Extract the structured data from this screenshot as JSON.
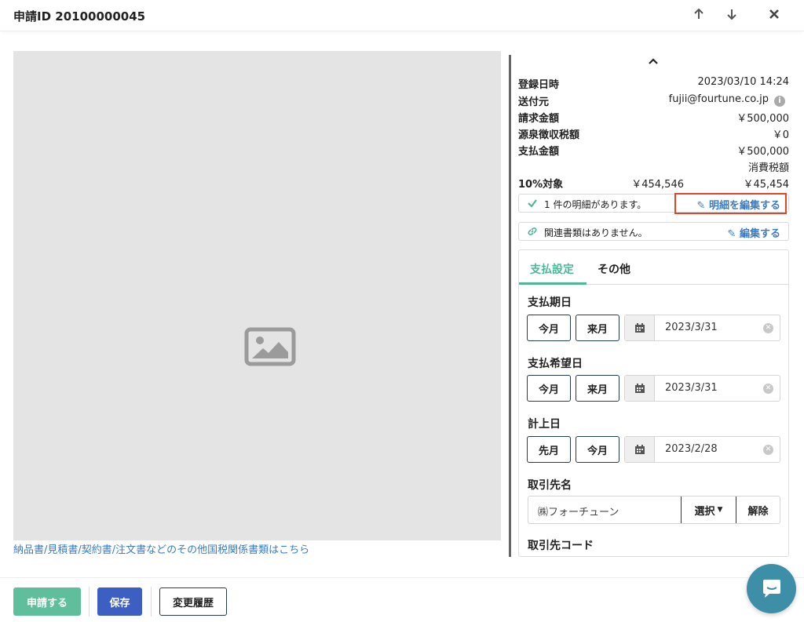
{
  "header": {
    "title": "申請ID 20100000045",
    "icons": [
      "arrow-up-icon",
      "arrow-down-icon",
      "close-icon"
    ]
  },
  "preview": {
    "placeholder_icon": "image-icon",
    "doc_link": "納品書/見積書/契約書/注文書などのその他国税関係書類はこちら"
  },
  "summary": {
    "registered_label": "登録日時",
    "registered_value": "2023/03/10 14:24",
    "sender_label": "送付元",
    "sender_value": "fujii@fourtune.co.jp",
    "invoice_amount_label": "請求金額",
    "invoice_amount_value": "￥500,000",
    "withholding_label": "源泉徴収税額",
    "withholding_value": "￥0",
    "payment_amount_label": "支払金額",
    "payment_amount_value": "￥500,000",
    "tax_header": "消費税額",
    "rate_label": "10%対象",
    "rate_base": "￥454,546",
    "rate_tax": "￥45,454"
  },
  "details_box": {
    "text": "1 件の明細があります。",
    "action": "明細を編集する"
  },
  "related_box": {
    "text": "関連書類はありません。",
    "action": "編集する"
  },
  "tabs": [
    {
      "label": "支払設定",
      "active": true
    },
    {
      "label": "その他",
      "active": false
    }
  ],
  "fields": {
    "due_date": {
      "label": "支払期日",
      "btn1": "今月",
      "btn2": "来月",
      "value": "2023/3/31"
    },
    "desired_date": {
      "label": "支払希望日",
      "btn1": "今月",
      "btn2": "来月",
      "value": "2023/3/31"
    },
    "booking_date": {
      "label": "計上日",
      "btn1": "先月",
      "btn2": "今月",
      "value": "2023/2/28"
    },
    "vendor": {
      "label": "取引先名",
      "value": "㈱フォーチューン",
      "select": "選択",
      "clear": "解除"
    },
    "vendor_code_label": "取引先コード"
  },
  "footer": {
    "submit": "申請する",
    "save": "保存",
    "history": "変更履歴"
  },
  "colors": {
    "accent_green": "#4fb797",
    "primary_blue": "#3d5fc4",
    "link_blue": "#3d7cc1",
    "highlight_red": "#e2452c",
    "chat_teal": "#3d8fa8"
  }
}
